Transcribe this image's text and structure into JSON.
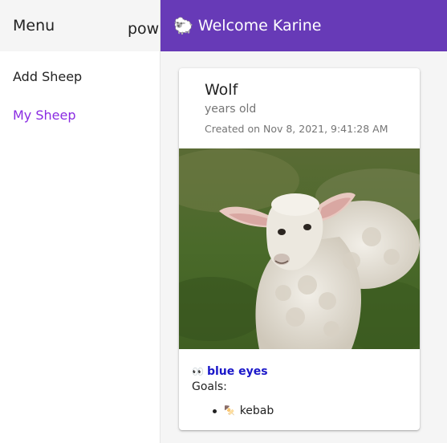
{
  "sidebar": {
    "title": "Menu",
    "overflow_text": "pow",
    "items": [
      {
        "label": "Add Sheep"
      },
      {
        "label": "My Sheep"
      }
    ]
  },
  "header": {
    "icon": "sheep-icon",
    "title": "Welcome Karine"
  },
  "card": {
    "name": "Wolf",
    "age_text": "years old",
    "created_text": "Created on Nov 8, 2021, 9:41:28 AM",
    "photo": "sheep-photo",
    "trait": {
      "icon": "eyes-icon",
      "label": "blue eyes"
    },
    "goals_label": "Goals:",
    "goals": [
      {
        "icon": "kebab-icon",
        "label": "kebab"
      }
    ]
  },
  "colors": {
    "accent": "#673ab7",
    "active_nav": "#8a2be2",
    "trait_link": "#1a17c9"
  }
}
